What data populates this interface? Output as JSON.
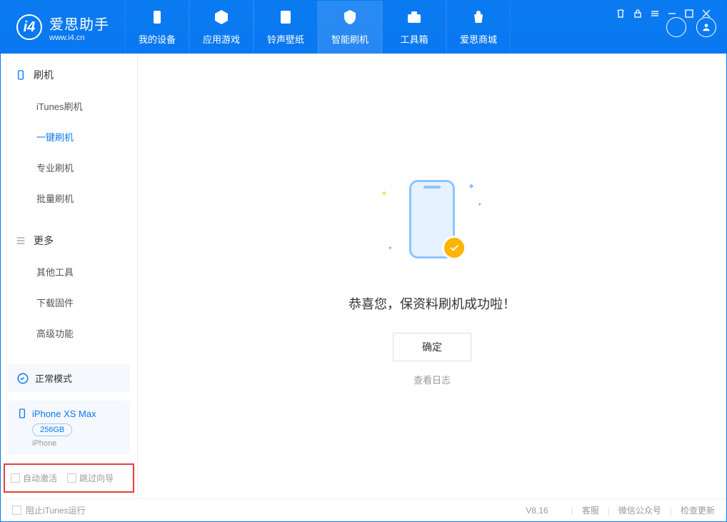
{
  "header": {
    "logo_title": "爱思助手",
    "logo_sub": "www.i4.cn",
    "nav": [
      {
        "label": "我的设备",
        "icon": "device"
      },
      {
        "label": "应用游戏",
        "icon": "cube"
      },
      {
        "label": "铃声壁纸",
        "icon": "music"
      },
      {
        "label": "智能刷机",
        "icon": "shield",
        "active": true
      },
      {
        "label": "工具箱",
        "icon": "toolbox"
      },
      {
        "label": "爱思商城",
        "icon": "store"
      }
    ],
    "right_icons": [
      "download-icon",
      "user-icon"
    ],
    "title_icons": [
      "tshirt-icon",
      "lock-icon",
      "menu-icon",
      "minimize-icon",
      "maximize-icon",
      "close-icon"
    ]
  },
  "sidebar": {
    "section1": {
      "title": "刷机",
      "items": [
        "iTunes刷机",
        "一键刷机",
        "专业刷机",
        "批量刷机"
      ],
      "active_index": 1
    },
    "section2": {
      "title": "更多",
      "items": [
        "其他工具",
        "下载固件",
        "高级功能"
      ]
    },
    "status": {
      "label": "正常模式"
    },
    "device": {
      "name": "iPhone XS Max",
      "capacity": "256GB",
      "type": "iPhone"
    },
    "options": {
      "opt1": "自动激活",
      "opt2": "跳过向导"
    }
  },
  "main": {
    "success_message": "恭喜您，保资料刷机成功啦！",
    "ok_button": "确定",
    "log_link": "查看日志"
  },
  "footer": {
    "block_itunes": "阻止iTunes运行",
    "version": "V8.16",
    "links": [
      "客服",
      "微信公众号",
      "检查更新"
    ]
  }
}
